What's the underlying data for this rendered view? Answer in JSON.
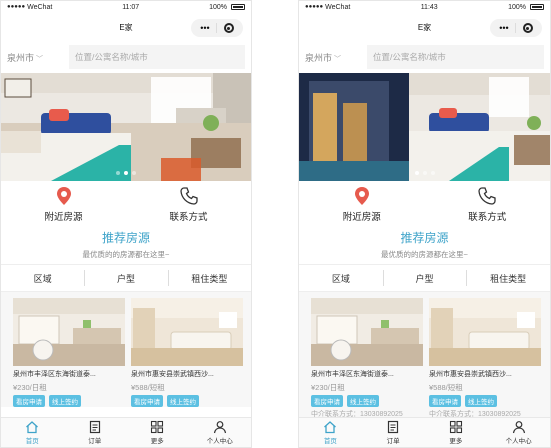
{
  "app": {
    "title": "E家"
  },
  "colors": {
    "accent": "#3ea3c9",
    "tag": "#5cc0e2",
    "pin": "#e65a4d"
  },
  "screens": [
    {
      "status": {
        "carrier": "WeChat",
        "time": "11:07",
        "battery": "100%"
      },
      "nav": {
        "title": "E家"
      },
      "city": "泉州市",
      "search": {
        "placeholder": "位置/公寓名称/城市"
      },
      "banner": {
        "slides": 3,
        "active": 1
      },
      "quick": {
        "nearby": "附近房源",
        "contact": "联系方式"
      },
      "section": {
        "title": "推荐房源",
        "subtitle": "最优质的的房源都在这里~"
      },
      "filters": [
        "区域",
        "户型",
        "租住类型"
      ],
      "cards": [
        {
          "title": "泉州市丰泽区东海街道泰...",
          "price": "¥230/日租",
          "tags": [
            "看房申请",
            "线上签约"
          ]
        },
        {
          "title": "泉州市惠安县崇武镇西沙...",
          "price": "¥588/短租",
          "tags": [
            "看房申请",
            "线上签约"
          ]
        }
      ],
      "tabs": [
        {
          "label": "首页",
          "icon": "home-icon"
        },
        {
          "label": "订单",
          "icon": "order-icon"
        },
        {
          "label": "更多",
          "icon": "grid-icon"
        },
        {
          "label": "个人中心",
          "icon": "user-icon"
        }
      ]
    },
    {
      "status": {
        "carrier": "WeChat",
        "time": "11:43",
        "battery": "100%"
      },
      "nav": {
        "title": "E家"
      },
      "city": "泉州市",
      "search": {
        "placeholder": "位置/公寓名称/城市"
      },
      "banner": {
        "slides": 3,
        "active": 0
      },
      "quick": {
        "nearby": "附近房源",
        "contact": "联系方式"
      },
      "section": {
        "title": "推荐房源",
        "subtitle": "最优质的的房源都在这里~"
      },
      "filters": [
        "区域",
        "户型",
        "租住类型"
      ],
      "cards": [
        {
          "title": "泉州市丰泽区东海街道泰...",
          "price": "¥230/日租",
          "tags": [
            "看房申请",
            "线上签约"
          ],
          "agent": "中介联系方式：13030892025"
        },
        {
          "title": "泉州市惠安县崇武镇西沙...",
          "price": "¥588/短租",
          "tags": [
            "看房申请",
            "线上签约"
          ],
          "agent": "中介联系方式：13030892025"
        }
      ],
      "tabs": [
        {
          "label": "首页",
          "icon": "home-icon"
        },
        {
          "label": "订单",
          "icon": "order-icon"
        },
        {
          "label": "更多",
          "icon": "grid-icon"
        },
        {
          "label": "个人中心",
          "icon": "user-icon"
        }
      ]
    }
  ]
}
